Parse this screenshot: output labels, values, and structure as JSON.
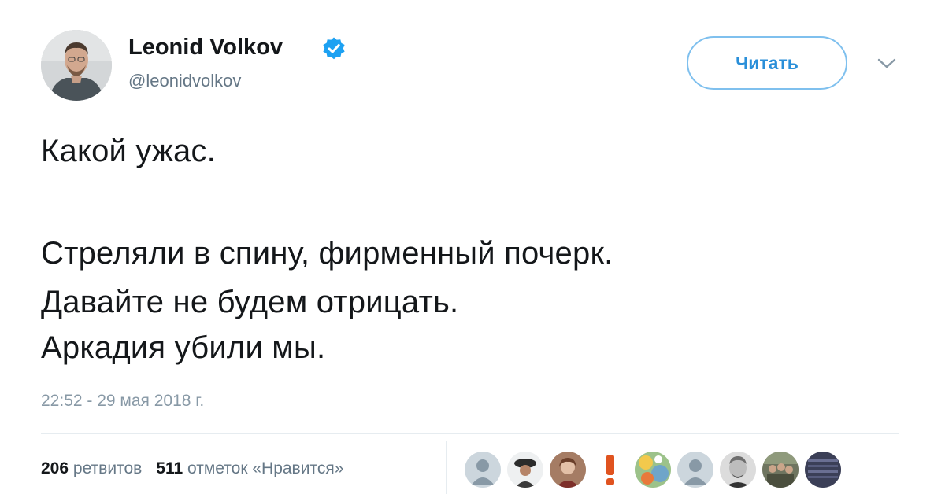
{
  "author": {
    "display_name": "Leonid Volkov",
    "handle": "@leonidvolkov",
    "verified": true
  },
  "follow_button": {
    "label": "Читать"
  },
  "tweet": {
    "lines": [
      "Какой ужас.",
      "Стреляли в спину, фирменный почерк.",
      "Давайте не будем отрицать.",
      "Аркадия убили мы."
    ],
    "timestamp": "22:52 - 29 мая 2018 г."
  },
  "stats": {
    "retweets_count": "206",
    "retweets_label": "ретвитов",
    "likes_count": "511",
    "likes_label": "отметок «Нравится»"
  },
  "likers": [
    {
      "avatar": "default-avatar"
    },
    {
      "avatar": "person-in-hat-avatar"
    },
    {
      "avatar": "person-photo-avatar"
    },
    {
      "avatar": "exclamation-avatar"
    },
    {
      "avatar": "colorful-avatar"
    },
    {
      "avatar": "default-avatar"
    },
    {
      "avatar": "portrait-avatar"
    },
    {
      "avatar": "group-photo-avatar"
    },
    {
      "avatar": "pattern-avatar"
    }
  ],
  "colors": {
    "accent": "#1da1f2",
    "follow_text": "#2a8fd9",
    "text": "#14171a",
    "secondary_text": "#657786",
    "divider": "#e6ecf0"
  }
}
